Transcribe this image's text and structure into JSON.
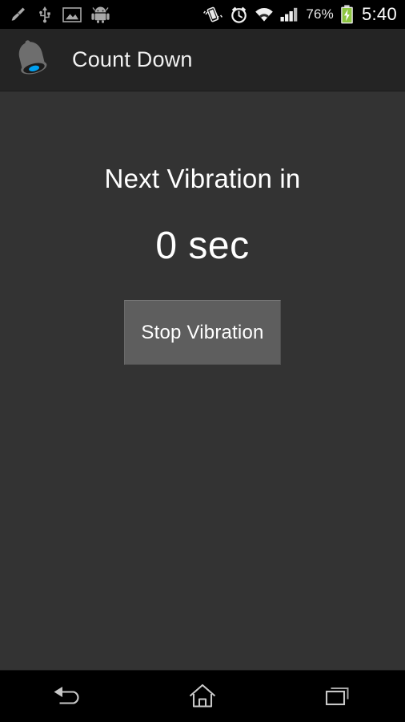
{
  "status_bar": {
    "left_icons": [
      {
        "name": "cleaner-broom-icon",
        "label": "cleaner"
      },
      {
        "name": "usb-icon",
        "label": "usb"
      },
      {
        "name": "image-icon",
        "label": "screenshot"
      },
      {
        "name": "android-robot-icon",
        "label": "android"
      }
    ],
    "right_icons": [
      {
        "name": "vibrate-mode-icon",
        "label": "vibrate"
      },
      {
        "name": "alarm-clock-icon",
        "label": "alarm"
      },
      {
        "name": "wifi-icon",
        "label": "wifi"
      },
      {
        "name": "cellular-signal-icon",
        "label": "signal"
      }
    ],
    "battery_percent": "76%",
    "battery_icon": "battery-charging-icon",
    "clock": "5:40"
  },
  "action_bar": {
    "icon": "bell-icon",
    "title": "Count Down"
  },
  "main": {
    "headline": "Next Vibration in",
    "countdown": "0 sec",
    "stop_button_label": "Stop Vibration"
  },
  "nav_bar": {
    "back": "back-icon",
    "home": "home-icon",
    "recents": "recent-apps-icon"
  },
  "colors": {
    "status_bar_bg": "#000000",
    "action_bar_bg": "#242424",
    "content_bg": "#333333",
    "button_bg": "#5e5e5e",
    "text_primary": "#ffffff",
    "bell_body": "#6e6e6e",
    "bell_clapper": "#00a0f0",
    "battery_green": "#8ec641"
  }
}
